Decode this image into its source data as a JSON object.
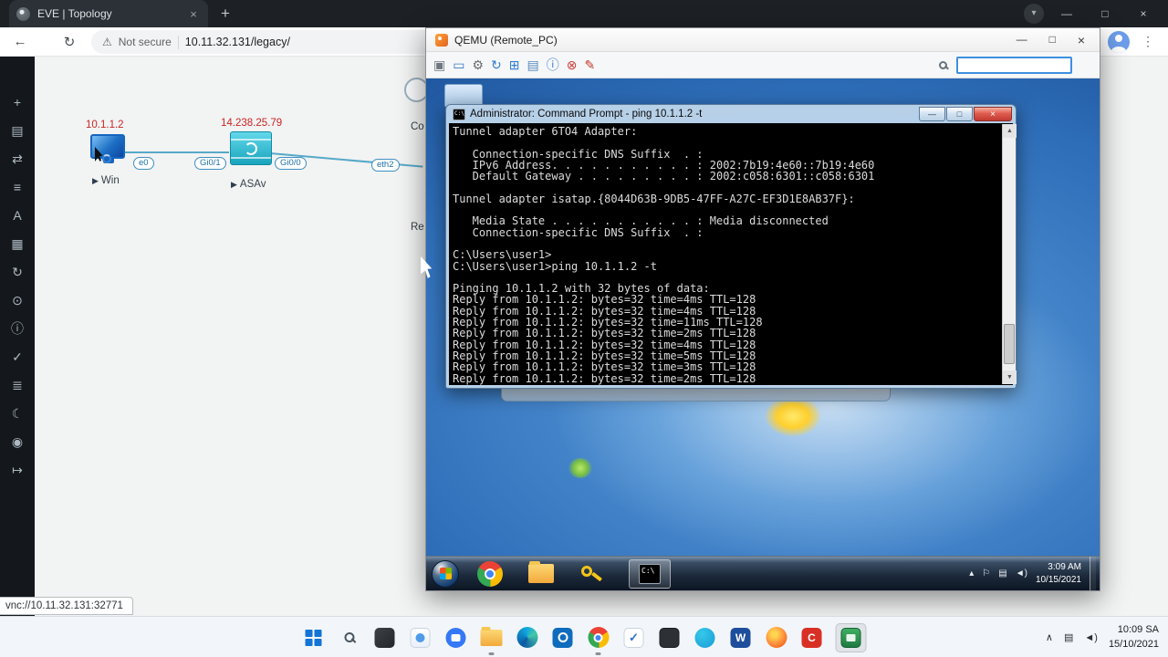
{
  "browser": {
    "tab_title": "EVE | Topology",
    "security_label": "Not secure",
    "url": "10.11.32.131/legacy/",
    "status_text": "vnc://10.11.32.131:32771"
  },
  "icons": {
    "back": "←",
    "reload": "↻",
    "warning": "⚠",
    "kebab": "⋮",
    "new_tab": "+",
    "tab_close": "×",
    "tab_search": "▾",
    "minimize": "—",
    "maximize": "□",
    "close": "×",
    "play": "▶",
    "up_arrow": "▲",
    "down_arrow": "▼",
    "cmd_label": "C:\\",
    "check": "✓",
    "chevron_up": "∧",
    "volume": "◄)",
    "tray_up": "▴",
    "tray_flag": "⚐",
    "tray_net": "▤",
    "letter_word": "W",
    "letter_c": "C"
  },
  "eve": {
    "sidebar": [
      {
        "name": "add-object",
        "glyph": "+"
      },
      {
        "name": "nodes",
        "glyph": "▤"
      },
      {
        "name": "networks",
        "glyph": "⇄"
      },
      {
        "name": "startup-configs",
        "glyph": "≡"
      },
      {
        "name": "text-objects",
        "glyph": "A"
      },
      {
        "name": "shapes",
        "glyph": "▦"
      },
      {
        "name": "refresh-topology",
        "glyph": "↻"
      },
      {
        "name": "zoom",
        "glyph": "⊙"
      },
      {
        "name": "status",
        "glyph": "ⓘ"
      },
      {
        "name": "configured-nodes",
        "glyph": "✓"
      },
      {
        "name": "logs",
        "glyph": "≣"
      },
      {
        "name": "dark-mode",
        "glyph": "☾"
      },
      {
        "name": "shutdown-all",
        "glyph": "◉"
      },
      {
        "name": "logout",
        "glyph": "↦"
      }
    ]
  },
  "topology": {
    "nodes": {
      "win": {
        "name": "Win",
        "ip": "10.1.1.2"
      },
      "asav": {
        "name": "ASAv",
        "ip": "14.238.25.79"
      }
    },
    "interfaces": [
      "e0",
      "Gi0/1",
      "Gi0/0",
      "eth2"
    ],
    "partial_labels": [
      "Co",
      "Re"
    ]
  },
  "qemu": {
    "title": "QEMU (Remote_PC)",
    "toolbar_icons": [
      {
        "name": "machine",
        "glyph": "▣"
      },
      {
        "name": "display",
        "glyph": "▭"
      },
      {
        "name": "settings",
        "glyph": "⚙"
      },
      {
        "name": "refresh",
        "glyph": "↻"
      },
      {
        "name": "virtual-screens",
        "glyph": "⊞"
      },
      {
        "name": "stats",
        "glyph": "▤"
      },
      {
        "name": "info",
        "glyph": "ⓘ"
      },
      {
        "name": "power-off",
        "glyph": "⊗"
      },
      {
        "name": "edit-display",
        "glyph": "✎"
      }
    ],
    "search_value": ""
  },
  "cmd": {
    "title": "Administrator: Command Prompt - ping 10.1.1.2 -t",
    "lines": [
      "Tunnel adapter 6TO4 Adapter:",
      "",
      "   Connection-specific DNS Suffix  . :",
      "   IPv6 Address. . . . . . . . . . . : 2002:7b19:4e60::7b19:4e60",
      "   Default Gateway . . . . . . . . . : 2002:c058:6301::c058:6301",
      "",
      "Tunnel adapter isatap.{8044D63B-9DB5-47FF-A27C-EF3D1E8AB37F}:",
      "",
      "   Media State . . . . . . . . . . . : Media disconnected",
      "   Connection-specific DNS Suffix  . :",
      "",
      "C:\\Users\\user1>",
      "C:\\Users\\user1>ping 10.1.1.2 -t",
      "",
      "Pinging 10.1.1.2 with 32 bytes of data:",
      "Reply from 10.1.1.2: bytes=32 time=4ms TTL=128",
      "Reply from 10.1.1.2: bytes=32 time=4ms TTL=128",
      "Reply from 10.1.1.2: bytes=32 time=11ms TTL=128",
      "Reply from 10.1.1.2: bytes=32 time=2ms TTL=128",
      "Reply from 10.1.1.2: bytes=32 time=4ms TTL=128",
      "Reply from 10.1.1.2: bytes=32 time=5ms TTL=128",
      "Reply from 10.1.1.2: bytes=32 time=3ms TTL=128",
      "Reply from 10.1.1.2: bytes=32 time=2ms TTL=128"
    ]
  },
  "win7": {
    "taskbar": {
      "time": "3:09 AM",
      "date": "10/15/2021"
    },
    "app_icons": [
      "start-orb",
      "chrome",
      "file-explorer",
      "unikey",
      "command-prompt-active"
    ]
  },
  "win11": {
    "taskbar": {
      "time": "10:09 SA",
      "date": "15/10/2021"
    },
    "app_icons": [
      "start",
      "search",
      "widgets",
      "photos",
      "chat",
      "file-explorer",
      "edge",
      "outlook",
      "chrome",
      "tasks",
      "terminal",
      "messenger",
      "word",
      "firefox",
      "capcut",
      "qemu-active"
    ]
  }
}
